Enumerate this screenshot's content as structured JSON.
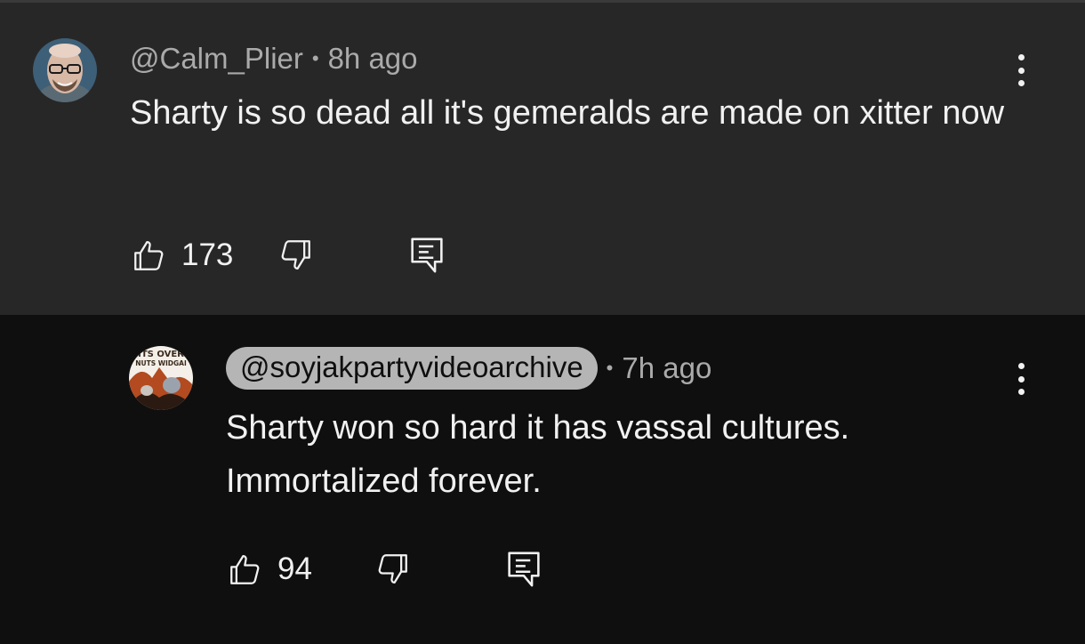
{
  "comments": [
    {
      "handle": "@Calm_Plier",
      "separator": "•",
      "time": "8h ago",
      "text": "Sharty is so dead all it's gemeralds are made on xitter now",
      "likes": "173"
    },
    {
      "handle": "@soyjakpartyvideoarchive",
      "separator": "•",
      "time": "7h ago",
      "text_lines": [
        "Sharty won so hard it has vassal cultures.",
        "Immortalized forever."
      ],
      "likes": "94",
      "avatar_caption": [
        "ITS OVER",
        "NUTS WIDGAI"
      ]
    }
  ],
  "icons": {
    "like": "thumbs-up-icon",
    "dislike": "thumbs-down-icon",
    "reply": "reply-comment-icon",
    "menu": "more-vertical-icon"
  },
  "colors": {
    "parent_bg": "#272727",
    "reply_bg": "#0f0f0f",
    "text": "#f1f1f1",
    "meta": "#aaaaaa",
    "chip_bg": "#b5b5b5"
  }
}
